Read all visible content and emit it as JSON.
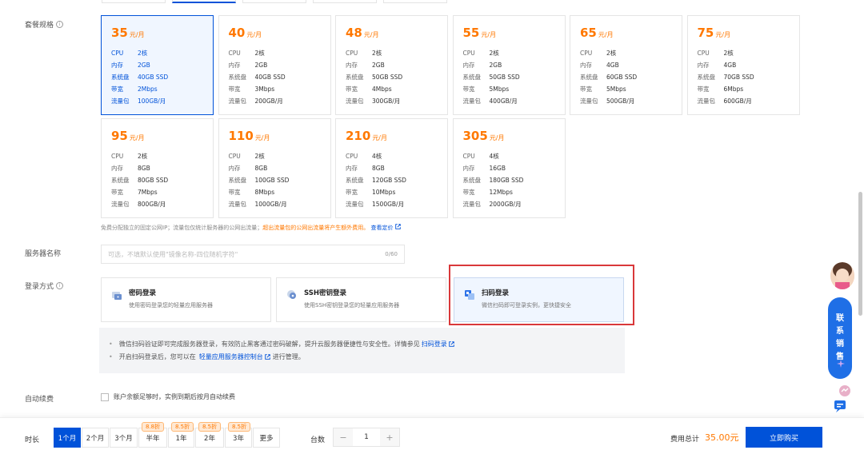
{
  "labels": {
    "plan_spec": "套餐规格",
    "server_name": "服务器名称",
    "login_method": "登录方式",
    "auto_renew": "自动续费",
    "duration": "时长",
    "quantity": "台数"
  },
  "price_unit": "元/月",
  "spec_keys": [
    "CPU",
    "内存",
    "系统盘",
    "带宽",
    "流量包"
  ],
  "plans": [
    {
      "price": "35",
      "specs": [
        "2核",
        "2GB",
        "40GB SSD",
        "2Mbps",
        "100GB/月"
      ],
      "selected": true
    },
    {
      "price": "40",
      "specs": [
        "2核",
        "2GB",
        "40GB SSD",
        "3Mbps",
        "200GB/月"
      ]
    },
    {
      "price": "48",
      "specs": [
        "2核",
        "2GB",
        "50GB SSD",
        "4Mbps",
        "300GB/月"
      ]
    },
    {
      "price": "55",
      "specs": [
        "2核",
        "2GB",
        "50GB SSD",
        "5Mbps",
        "400GB/月"
      ]
    },
    {
      "price": "65",
      "specs": [
        "2核",
        "4GB",
        "60GB SSD",
        "5Mbps",
        "500GB/月"
      ]
    },
    {
      "price": "75",
      "specs": [
        "2核",
        "4GB",
        "70GB SSD",
        "6Mbps",
        "600GB/月"
      ]
    },
    {
      "price": "95",
      "specs": [
        "2核",
        "8GB",
        "80GB SSD",
        "7Mbps",
        "800GB/月"
      ]
    },
    {
      "price": "110",
      "specs": [
        "2核",
        "8GB",
        "100GB SSD",
        "8Mbps",
        "1000GB/月"
      ]
    },
    {
      "price": "210",
      "specs": [
        "4核",
        "8GB",
        "120GB SSD",
        "10Mbps",
        "1500GB/月"
      ]
    },
    {
      "price": "305",
      "specs": [
        "4核",
        "16GB",
        "180GB SSD",
        "12Mbps",
        "2000GB/月"
      ]
    }
  ],
  "plan_note": {
    "text": "免费分配独立的固定公网IP；流量包仅统计服务器的公网出流量；",
    "warn": "超出流量包的公网出流量将产生额外费用。",
    "link": "查看定价"
  },
  "server_name_input": {
    "placeholder": "可选，不填默认使用\"镜像名称-四位随机字符\"",
    "count": "0/60"
  },
  "login_options": [
    {
      "title": "密码登录",
      "desc": "使用密码登录您的轻量应用服务器"
    },
    {
      "title": "SSH密钥登录",
      "desc": "使用SSH密钥登录您的轻量应用服务器"
    },
    {
      "title": "扫码登录",
      "desc": "微信扫码即可登录实例，更快捷安全",
      "selected": true
    }
  ],
  "tips": [
    {
      "text": "微信扫码验证即可完成服务器登录，有效防止黑客通过密码破解，提升云服务器便捷性与安全性。详情参见",
      "link": "扫码登录",
      "after": ""
    },
    {
      "text": "开启扫码登录后，您可以在",
      "link": "轻量应用服务器控制台",
      "after": "进行管理。"
    }
  ],
  "auto_renew_text": "账户余额足够时，实例到期后按月自动续费",
  "durations": [
    {
      "label": "1个月",
      "active": true
    },
    {
      "label": "2个月"
    },
    {
      "label": "3个月"
    },
    {
      "label": "半年",
      "discount": "8.8折"
    },
    {
      "label": "1年",
      "discount": "8.5折"
    },
    {
      "label": "2年",
      "discount": "8.5折"
    },
    {
      "label": "3年",
      "discount": "8.5折"
    },
    {
      "label": "更多"
    }
  ],
  "quantity": {
    "minus": "−",
    "value": "1",
    "plus": "+"
  },
  "total": {
    "label": "费用总计",
    "value": "35.00元"
  },
  "buy_button": "立即购买",
  "contact_sales": [
    "联",
    "系",
    "销",
    "售"
  ],
  "colors": {
    "primary": "#0052d9",
    "price": "#ff7800",
    "highlight": "#d9383a"
  }
}
